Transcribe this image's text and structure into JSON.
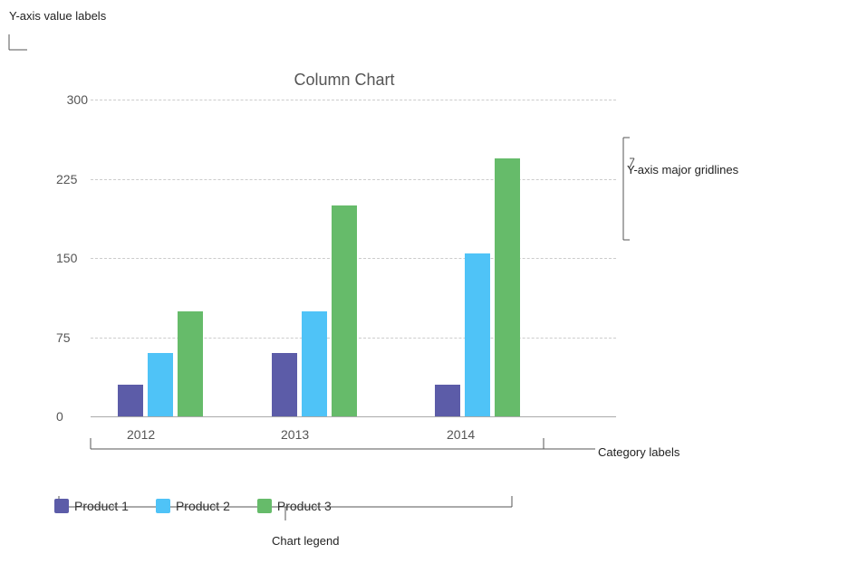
{
  "chart": {
    "title": "Column Chart",
    "yaxis": {
      "values": [
        0,
        75,
        150,
        225,
        300
      ],
      "max": 300
    },
    "categories": [
      "2012",
      "2013",
      "2014"
    ],
    "series": [
      {
        "name": "Product 1",
        "color": "#5c5ca8",
        "class": "bar-product1",
        "values": [
          30,
          60,
          30
        ]
      },
      {
        "name": "Product 2",
        "color": "#4fc3f7",
        "class": "bar-product2",
        "values": [
          60,
          100,
          155
        ]
      },
      {
        "name": "Product 3",
        "color": "#66bb6a",
        "class": "bar-product3",
        "values": [
          100,
          200,
          245
        ]
      }
    ],
    "legend": {
      "items": [
        {
          "label": "Product 1",
          "color": "#5c5ca8"
        },
        {
          "label": "Product 2",
          "color": "#4fc3f7"
        },
        {
          "label": "Product 3",
          "color": "#66bb6a"
        }
      ]
    }
  },
  "annotations": {
    "yaxis_value_labels": "Y-axis value labels",
    "yaxis_major_gridlines": "Y-axis major gridlines",
    "category_labels": "Category labels",
    "chart_legend": "Chart legend"
  }
}
